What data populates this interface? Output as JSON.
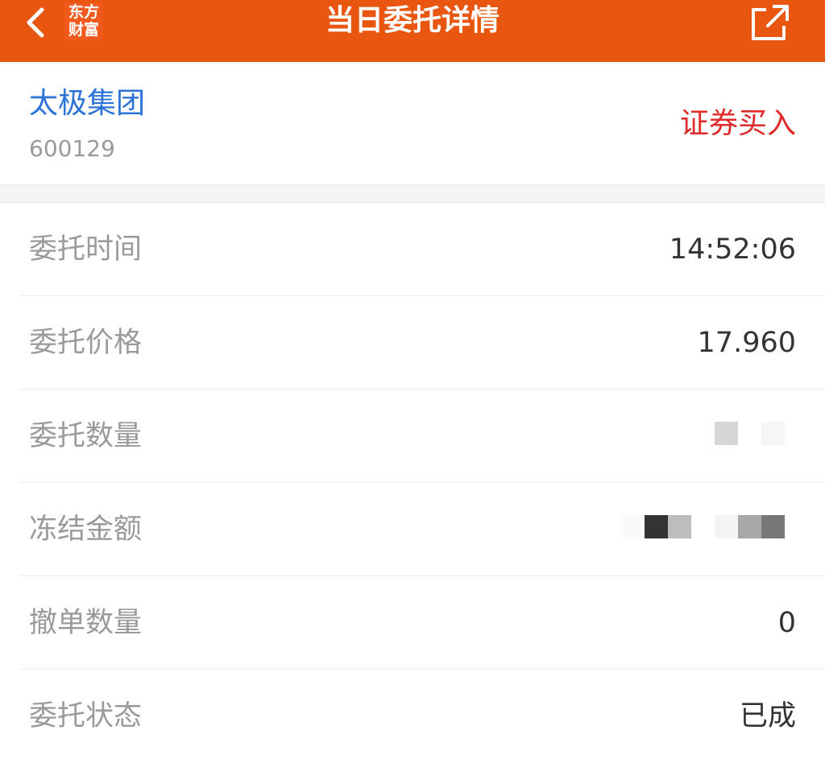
{
  "header": {
    "title": "当日委托详情",
    "logo_line1": "东方",
    "logo_line2": "财富",
    "back_icon": "chevron-left-icon",
    "share_icon": "share-external-icon",
    "background": "#e9560f"
  },
  "stock": {
    "name": "太极集团",
    "code": "600129",
    "action": "证券买入"
  },
  "details": [
    {
      "label": "委托时间",
      "value": "14:52:06"
    },
    {
      "label": "委托价格",
      "value": "17.960"
    },
    {
      "label": "委托数量",
      "value": null
    },
    {
      "label": "冻结金额",
      "value": null
    },
    {
      "label": "撤单数量",
      "value": "0"
    },
    {
      "label": "委托状态",
      "value": "已成"
    }
  ],
  "colors": {
    "accent": "#e9560f",
    "stock_name": "#2b73d6",
    "action": "#e02a2a",
    "label": "#9a9a9a",
    "value": "#333333"
  }
}
